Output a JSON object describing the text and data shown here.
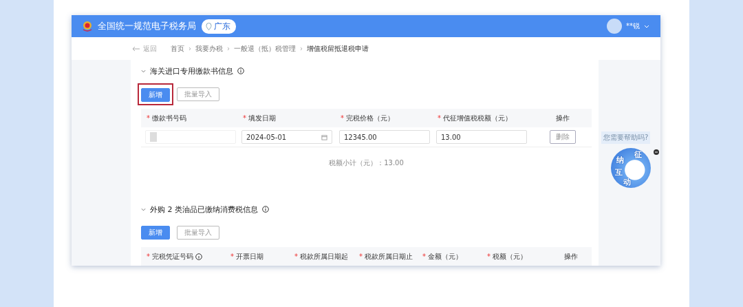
{
  "header": {
    "title": "全国统一规范电子税务局",
    "region": "广东",
    "user": "**锐"
  },
  "breadcrumb": {
    "back": "返回",
    "items": [
      "首页",
      "我要办税",
      "一般退（抵）税管理",
      "增值税留抵退税申请"
    ],
    "separator": "›"
  },
  "sections": [
    {
      "title": "海关进口专用缴款书信息",
      "expanded": true,
      "buttons": [
        {
          "label": "新增",
          "kind": "primary",
          "highlighted": true
        },
        {
          "label": "批量导入",
          "kind": "outline",
          "highlighted": false
        }
      ],
      "columns": [
        {
          "star": "*",
          "label": "缴款书号码",
          "info": false
        },
        {
          "star": "*",
          "label": "填发日期",
          "info": false
        },
        {
          "star": "*",
          "label": "完税价格（元）",
          "info": false
        },
        {
          "star": "*",
          "label": "代征增值税税额（元）",
          "info": false
        },
        {
          "label": "操作",
          "info": false
        }
      ],
      "rows": [
        {
          "cells": [
            {
              "kind": "redacted"
            },
            {
              "kind": "date",
              "value": "2024-05-01"
            },
            {
              "kind": "input",
              "value": "12345.00"
            },
            {
              "kind": "input",
              "value": "13.00"
            },
            {
              "kind": "button",
              "value": "删除"
            }
          ]
        }
      ],
      "subtotal": "税额小计（元）：13.00"
    },
    {
      "title": "外购 2 类油品已缴纳消费税信息",
      "expanded": true,
      "buttons": [
        {
          "label": "新增",
          "kind": "primary",
          "highlighted": false
        },
        {
          "label": "批量导入",
          "kind": "outline",
          "highlighted": false
        }
      ],
      "columns": [
        {
          "star": "*",
          "label": "完税凭证号码",
          "info": true
        },
        {
          "star": "*",
          "label": "开票日期",
          "info": false
        },
        {
          "star": "*",
          "label": "税款所属日期起",
          "info": false
        },
        {
          "star": "*",
          "label": "税款所属日期止",
          "info": false
        },
        {
          "star": "*",
          "label": "金额（元）",
          "info": false
        },
        {
          "star": "*",
          "label": "税额（元）",
          "info": false
        },
        {
          "label": "操作",
          "info": false
        }
      ]
    }
  ],
  "assistant": {
    "bubble": "您需要帮助吗?",
    "badge": [
      "征",
      "纳",
      "互",
      "动"
    ]
  }
}
